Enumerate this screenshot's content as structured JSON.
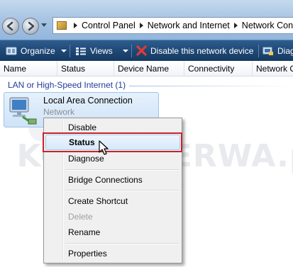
{
  "address_bar": {
    "breadcrumbs": [
      "Control Panel",
      "Network and Internet",
      "Network Conn"
    ]
  },
  "command_bar": {
    "organize_label": "Organize",
    "views_label": "Views",
    "disable_label": "Disable this network device",
    "diagnose_label": "Diag"
  },
  "columns": [
    "Name",
    "Status",
    "Device Name",
    "Connectivity",
    "Network C"
  ],
  "group": {
    "header": "LAN or High-Speed Internet (1)"
  },
  "connection": {
    "name": "Local Area Connection",
    "subtitle": "Network"
  },
  "watermark": "KOMPUTERWA.pl",
  "context_menu": {
    "disable": "Disable",
    "status": "Status",
    "diagnose": "Diagnose",
    "bridge": "Bridge Connections",
    "shortcut": "Create Shortcut",
    "delete": "Delete",
    "rename": "Rename",
    "properties": "Properties"
  },
  "colors": {
    "command_bar": "#1f4875",
    "group_header_text": "#1e3b9a",
    "highlight_box": "#c9242b"
  }
}
